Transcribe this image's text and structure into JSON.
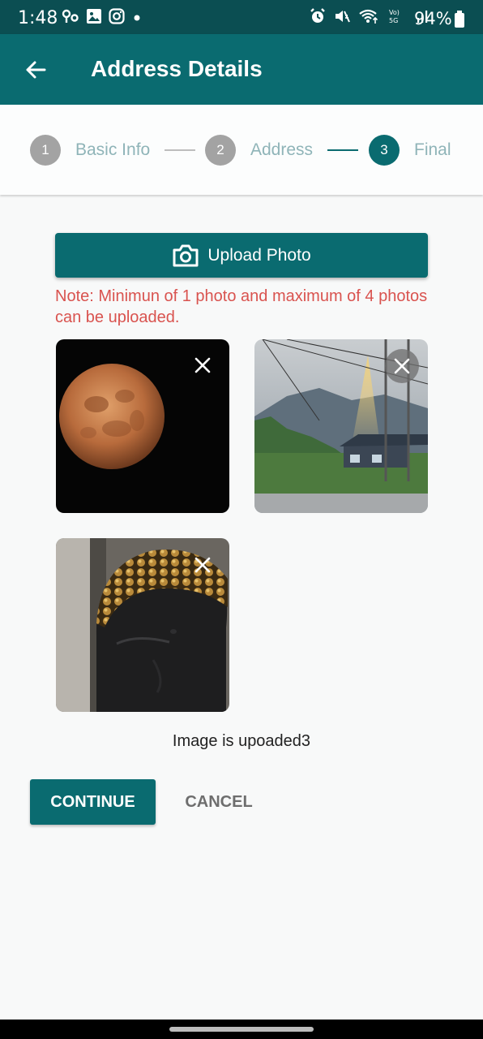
{
  "status_bar": {
    "time": "1:48",
    "battery": "94%",
    "left_icons": [
      "hotspot-icon",
      "gallery-icon",
      "instagram-icon",
      "dot-icon"
    ],
    "right_icons": [
      "alarm-icon",
      "mute-icon",
      "wifi-icon",
      "volte-5g-icon",
      "signal-icon",
      "battery-icon"
    ],
    "volte_text": "Vo) 5G"
  },
  "app_bar": {
    "title": "Address Details",
    "back_icon": "arrow-left-icon"
  },
  "stepper": {
    "steps": [
      {
        "number": "1",
        "label": "Basic Info",
        "state": "inactive"
      },
      {
        "number": "2",
        "label": "Address",
        "state": "inactive"
      },
      {
        "number": "3",
        "label": "Final",
        "state": "active"
      }
    ],
    "colors": {
      "active": "#0a6b70",
      "inactive": "#a3a3a3",
      "label": "#8fb4b8"
    }
  },
  "upload": {
    "button_label": "Upload Photo",
    "icon": "camera-icon",
    "note": "Note: Minimun of 1 photo and maximum of 4 photos can be uploaded."
  },
  "photos": [
    {
      "subject": "moon",
      "remove_icon": "close-icon"
    },
    {
      "subject": "mountain-house",
      "remove_icon": "close-icon"
    },
    {
      "subject": "buddha-statue",
      "remove_icon": "close-icon"
    }
  ],
  "upload_status": "Image is upoaded3",
  "actions": {
    "continue_label": "CONTINUE",
    "cancel_label": "CANCEL"
  },
  "colors": {
    "primary": "#0a6b70",
    "status_bar": "#0b4e52",
    "note": "#d9534f",
    "background": "#f8f9f9"
  }
}
